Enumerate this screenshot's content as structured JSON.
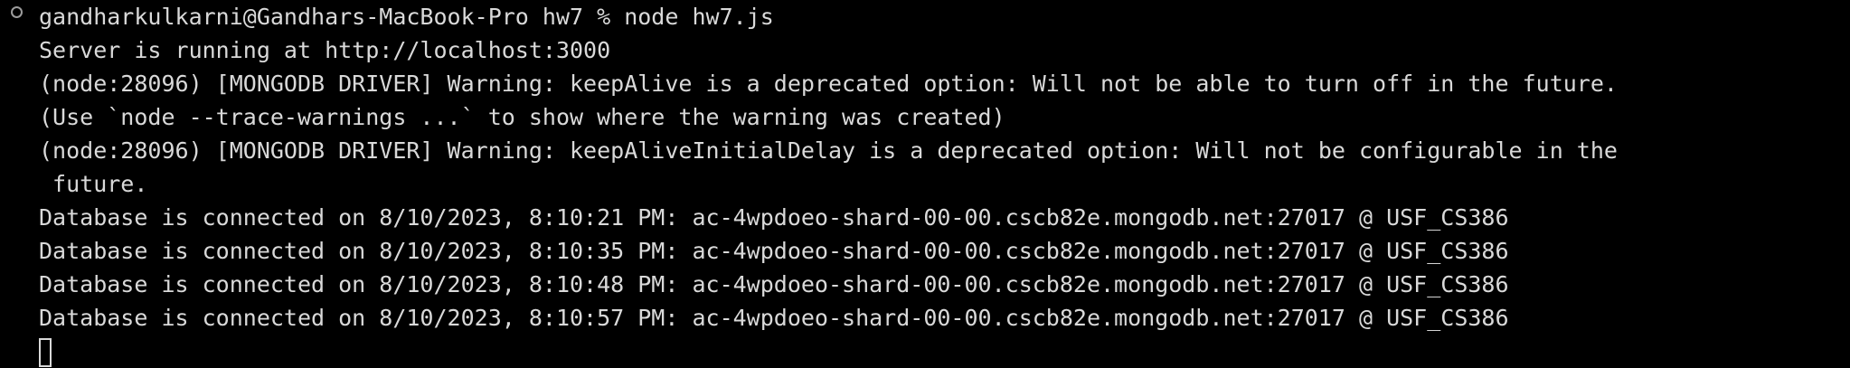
{
  "terminal": {
    "prompt": "gandharkulkarni@Gandhars-MacBook-Pro hw7 % node hw7.js",
    "lines": [
      "Server is running at http://localhost:3000",
      "(node:28096) [MONGODB DRIVER] Warning: keepAlive is a deprecated option: Will not be able to turn off in the future.",
      "(Use `node --trace-warnings ...` to show where the warning was created)",
      "(node:28096) [MONGODB DRIVER] Warning: keepAliveInitialDelay is a deprecated option: Will not be configurable in the",
      " future.",
      "Database is connected on 8/10/2023, 8:10:21 PM: ac-4wpdoeo-shard-00-00.cscb82e.mongodb.net:27017 @ USF_CS386",
      "Database is connected on 8/10/2023, 8:10:35 PM: ac-4wpdoeo-shard-00-00.cscb82e.mongodb.net:27017 @ USF_CS386",
      "Database is connected on 8/10/2023, 8:10:48 PM: ac-4wpdoeo-shard-00-00.cscb82e.mongodb.net:27017 @ USF_CS386",
      "Database is connected on 8/10/2023, 8:10:57 PM: ac-4wpdoeo-shard-00-00.cscb82e.mongodb.net:27017 @ USF_CS386"
    ]
  },
  "colors": {
    "background": "#000000",
    "text": "#d9d9d9",
    "status_circle": "#9b9b9b"
  }
}
